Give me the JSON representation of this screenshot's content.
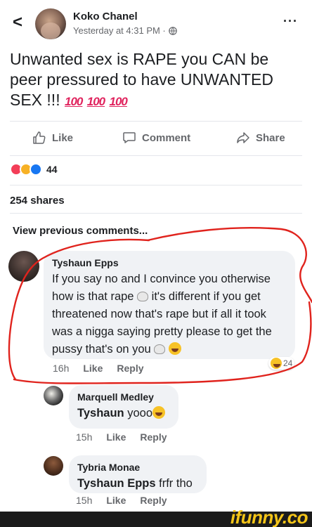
{
  "post": {
    "author": "Koko Chanel",
    "time": "Yesterday at 4:31 PM ·",
    "text": "Unwanted sex is RAPE you CAN be peer pressured to have UNWANTED SEX !!!",
    "emojis": [
      "100",
      "100",
      "100"
    ]
  },
  "actions": {
    "like": "Like",
    "comment": "Comment",
    "share": "Share"
  },
  "reactions": {
    "count": "44"
  },
  "shares": "254 shares",
  "view_previous": "View previous comments...",
  "comments": [
    {
      "name": "Tyshaun Epps",
      "text_1": "If you say no and I convince you otherwise how is that rape",
      "text_2": "it's different if you get threatened now that's rape but if all it took was a nigga saying pretty please to get the pussy that's on you",
      "time": "16h",
      "like": "Like",
      "reply": "Reply",
      "reaction_count": "24"
    },
    {
      "name": "Marquell Medley",
      "mention": "Tyshaun",
      "text": "yooo",
      "time": "15h",
      "like": "Like",
      "reply": "Reply"
    },
    {
      "name": "Tybria Monae",
      "mention": "Tyshaun Epps",
      "text": "frfr tho",
      "time": "15h",
      "like": "Like",
      "reply": "Reply"
    }
  ],
  "watermark": "ifunny.co",
  "colors": {
    "scribble": "#e0231d",
    "link_blue": "#1877f2",
    "meta_gray": "#65676b"
  }
}
